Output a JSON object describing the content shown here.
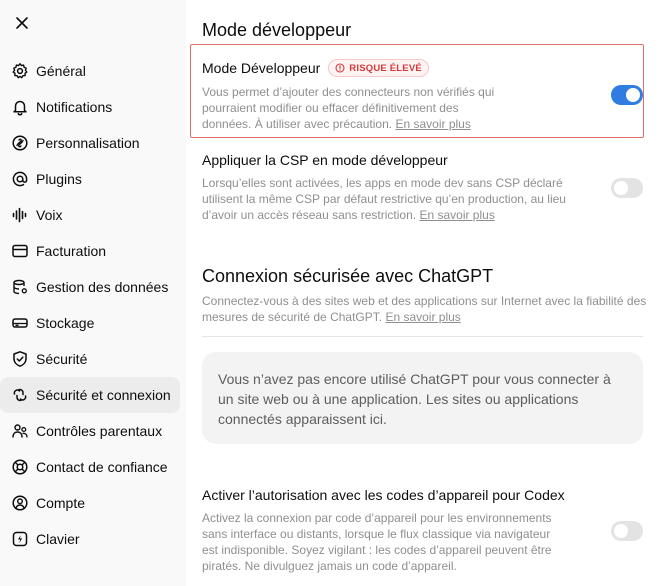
{
  "sidebar": {
    "items": [
      {
        "label": "Général",
        "icon": "gear-icon"
      },
      {
        "label": "Notifications",
        "icon": "bell-icon"
      },
      {
        "label": "Personnalisation",
        "icon": "swirl-icon"
      },
      {
        "label": "Plugins",
        "icon": "at-icon"
      },
      {
        "label": "Voix",
        "icon": "waveform-icon"
      },
      {
        "label": "Facturation",
        "icon": "credit-card-icon"
      },
      {
        "label": "Gestion des données",
        "icon": "database-icon"
      },
      {
        "label": "Stockage",
        "icon": "storage-icon"
      },
      {
        "label": "Sécurité",
        "icon": "shield-icon"
      },
      {
        "label": "Sécurité et connexion",
        "icon": "link-icon",
        "active": true
      },
      {
        "label": "Contrôles parentaux",
        "icon": "people-icon"
      },
      {
        "label": "Contact de confiance",
        "icon": "lifebuoy-icon"
      },
      {
        "label": "Compte",
        "icon": "user-icon"
      },
      {
        "label": "Clavier",
        "icon": "keyboard-icon"
      }
    ]
  },
  "main": {
    "title": "Mode développeur",
    "dev_mode": {
      "title": "Mode Développeur",
      "badge": "RISQUE ÉLEVÉ",
      "desc": "Vous permet d’ajouter des connecteurs non vérifiés qui pourraient modifier ou effacer définitivement des données. À utiliser avec précaution.",
      "link": "En savoir plus",
      "enabled": true
    },
    "csp": {
      "title": "Appliquer la CSP en mode développeur",
      "desc": "Lorsqu’elles sont activées, les apps en mode dev sans CSP déclaré utilisent la même CSP par défaut restrictive qu’en production, au lieu d’avoir un accès réseau sans restriction.",
      "link": "En savoir plus",
      "enabled": false
    },
    "secure_login": {
      "title": "Connexion sécurisée avec ChatGPT",
      "desc": "Connectez-vous à des sites web et des applications sur Internet avec la fiabilité des mesures de sécurité de ChatGPT.",
      "link": "En savoir plus",
      "empty_text": "Vous n’avez pas encore utilisé ChatGPT pour vous connecter à un site web ou à une application. Les sites ou applications connectés apparaissent ici."
    },
    "device_code": {
      "title": "Activer l’autorisation avec les codes d’appareil pour Codex",
      "desc": "Activez la connexion par code d’appareil pour les environnements sans interface ou distants, lorsque le flux classique via navigateur est indisponible. Soyez vigilant : les codes d’appareil peuvent être piratés. Ne divulguez jamais un code d’appareil.",
      "enabled": false
    }
  },
  "colors": {
    "accent": "#2f7de1",
    "danger": "#d33b3b",
    "highlight_border": "#e26d6d"
  }
}
